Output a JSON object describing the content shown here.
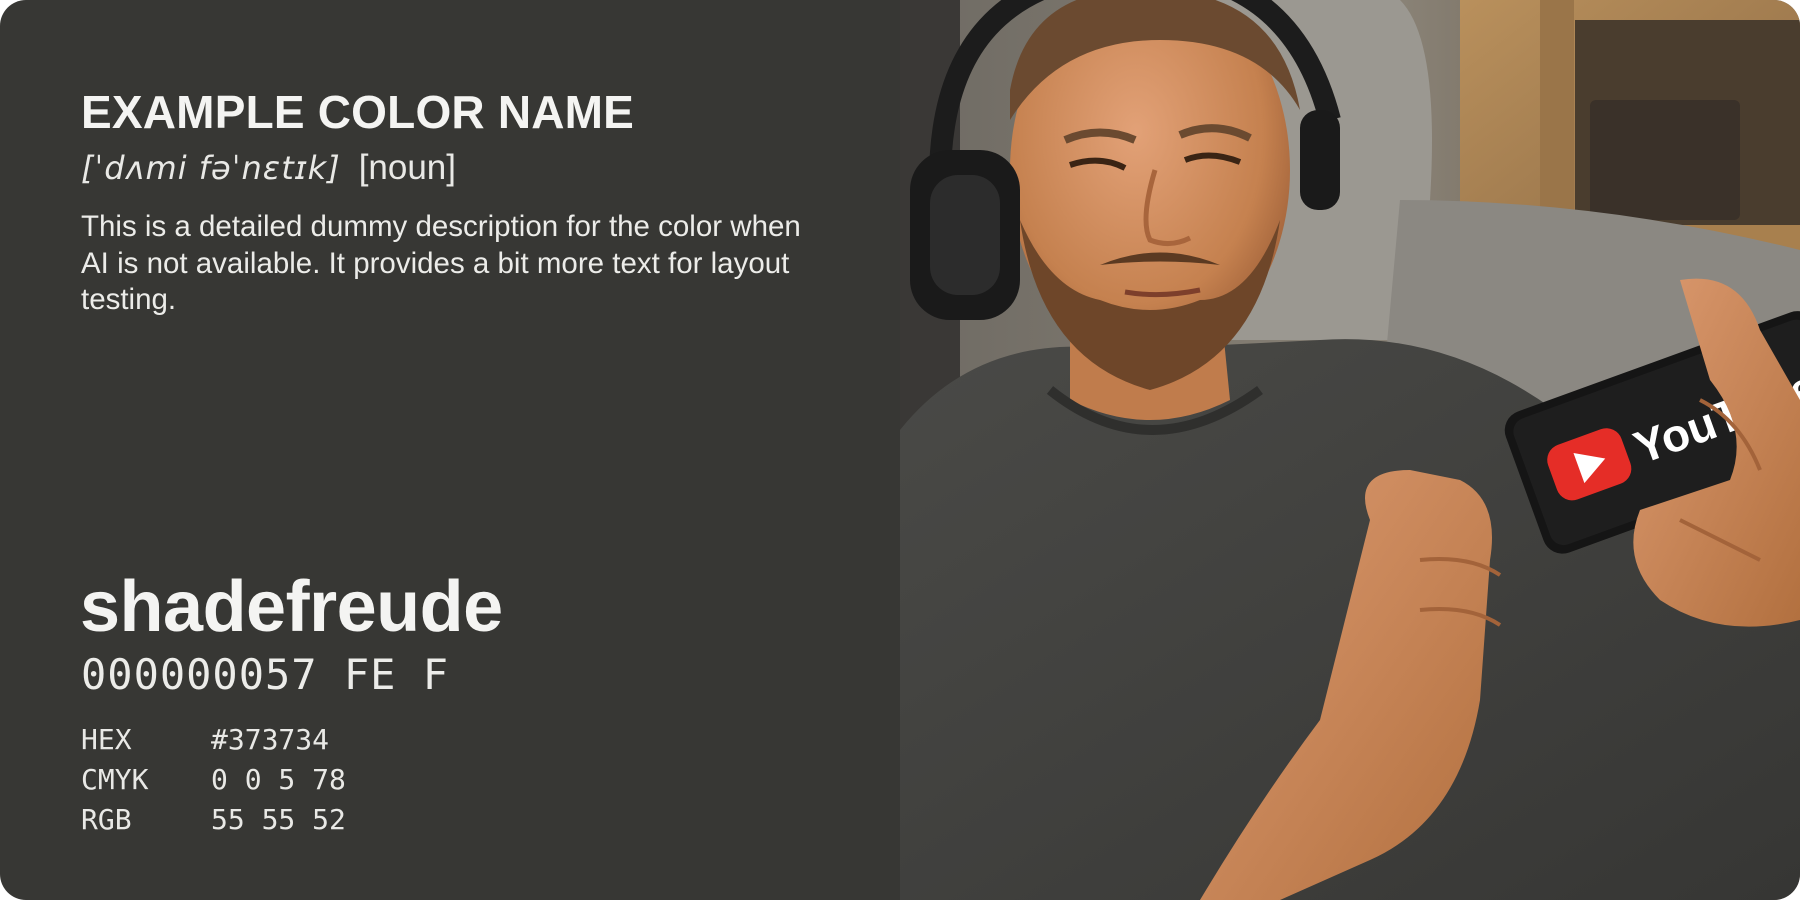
{
  "swatch": {
    "color_hex": "#373734",
    "title": "EXAMPLE COLOR NAME",
    "pronunciation": "[ˈdʌmi fəˈnɛtɪk]",
    "part_of_speech": "[noun]",
    "description": "This is a detailed dummy description for the color when AI is not available. It provides a bit more text for layout testing.",
    "brand_name": "shadefreude",
    "color_code": "000000057 FE F"
  },
  "specs": [
    {
      "label": "HEX",
      "value": "#373734"
    },
    {
      "label": "CMYK",
      "value": "0 0 5 78"
    },
    {
      "label": "RGB",
      "value": "55 55 52"
    }
  ],
  "photo": {
    "screen_text": "YouTube",
    "icons": [
      "headphones-icon",
      "play-icon"
    ],
    "colors": {
      "shirt": "#3f3f3d",
      "skin": "#c9855a",
      "couch": "#8d8a84",
      "wood": "#a47a4a",
      "logo_red": "#e52d27"
    }
  }
}
